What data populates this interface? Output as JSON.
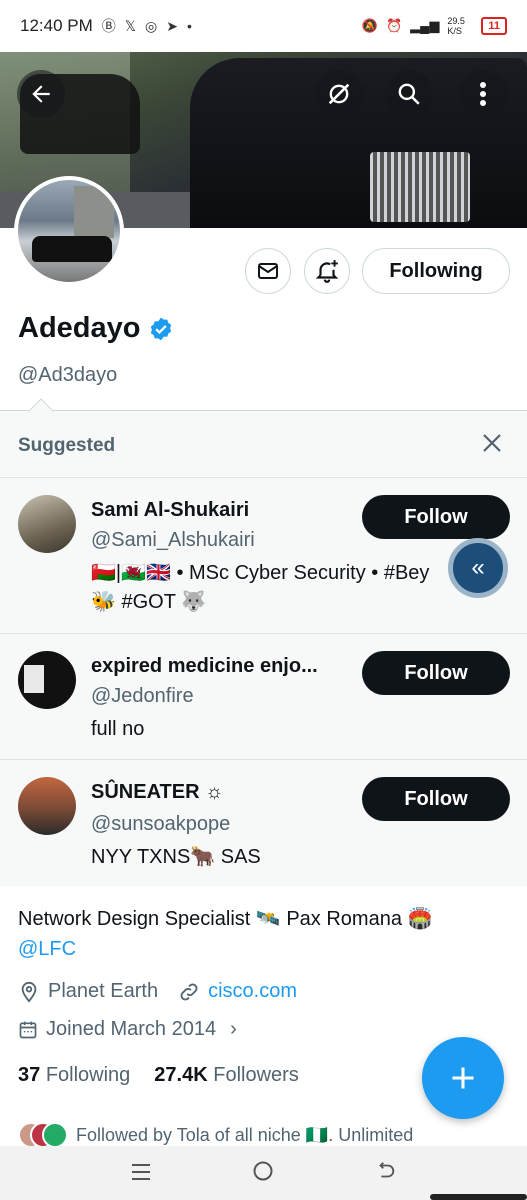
{
  "status_bar": {
    "time": "12:40 PM",
    "icons": [
      "b-icon",
      "x-icon",
      "threads-icon",
      "telegram-icon",
      "dot"
    ],
    "net_speed": "29.5 K/S",
    "battery": "11"
  },
  "profile": {
    "display_name": "Adedayo",
    "handle": "@Ad3dayo",
    "following_label": "Following",
    "verified_color": "#1d9bf0"
  },
  "suggested": {
    "title": "Suggested",
    "items": [
      {
        "name": "Sami Al-Shukairi",
        "handle": "@Sami_Alshukairi",
        "bio_line1": "🇴🇲|🏴󠁧󠁢󠁷󠁬󠁳󠁿🇬🇧 • MSc Cyber Security • #Bey",
        "bio_line2": "🐝 #GOT 🐺",
        "follow_label": "Follow"
      },
      {
        "name": "expired medicine enjo...",
        "handle": "@Jedonfire",
        "bio_line1": "full no",
        "follow_label": "Follow"
      },
      {
        "name": "SÛNEATER ☼",
        "handle": "@sunsoakpope",
        "bio_line1": "NYY TXNS🐂 SAS",
        "follow_label": "Follow"
      }
    ]
  },
  "bio": {
    "text": "Network Design Specialist 🛰️ Pax Romana 🏟️",
    "mention": "@LFC",
    "location": "Planet Earth",
    "website": "cisco.com",
    "joined": "Joined March 2014"
  },
  "stats": {
    "following_count": "37",
    "following_label": "Following",
    "followers_count": "27.4K",
    "followers_label": "Followers"
  },
  "followed_by": "Followed by Tola of all niche 🇳🇬. Unlimited",
  "colors": {
    "accent": "#1d9bf0",
    "follow_button": "#0f1419"
  }
}
